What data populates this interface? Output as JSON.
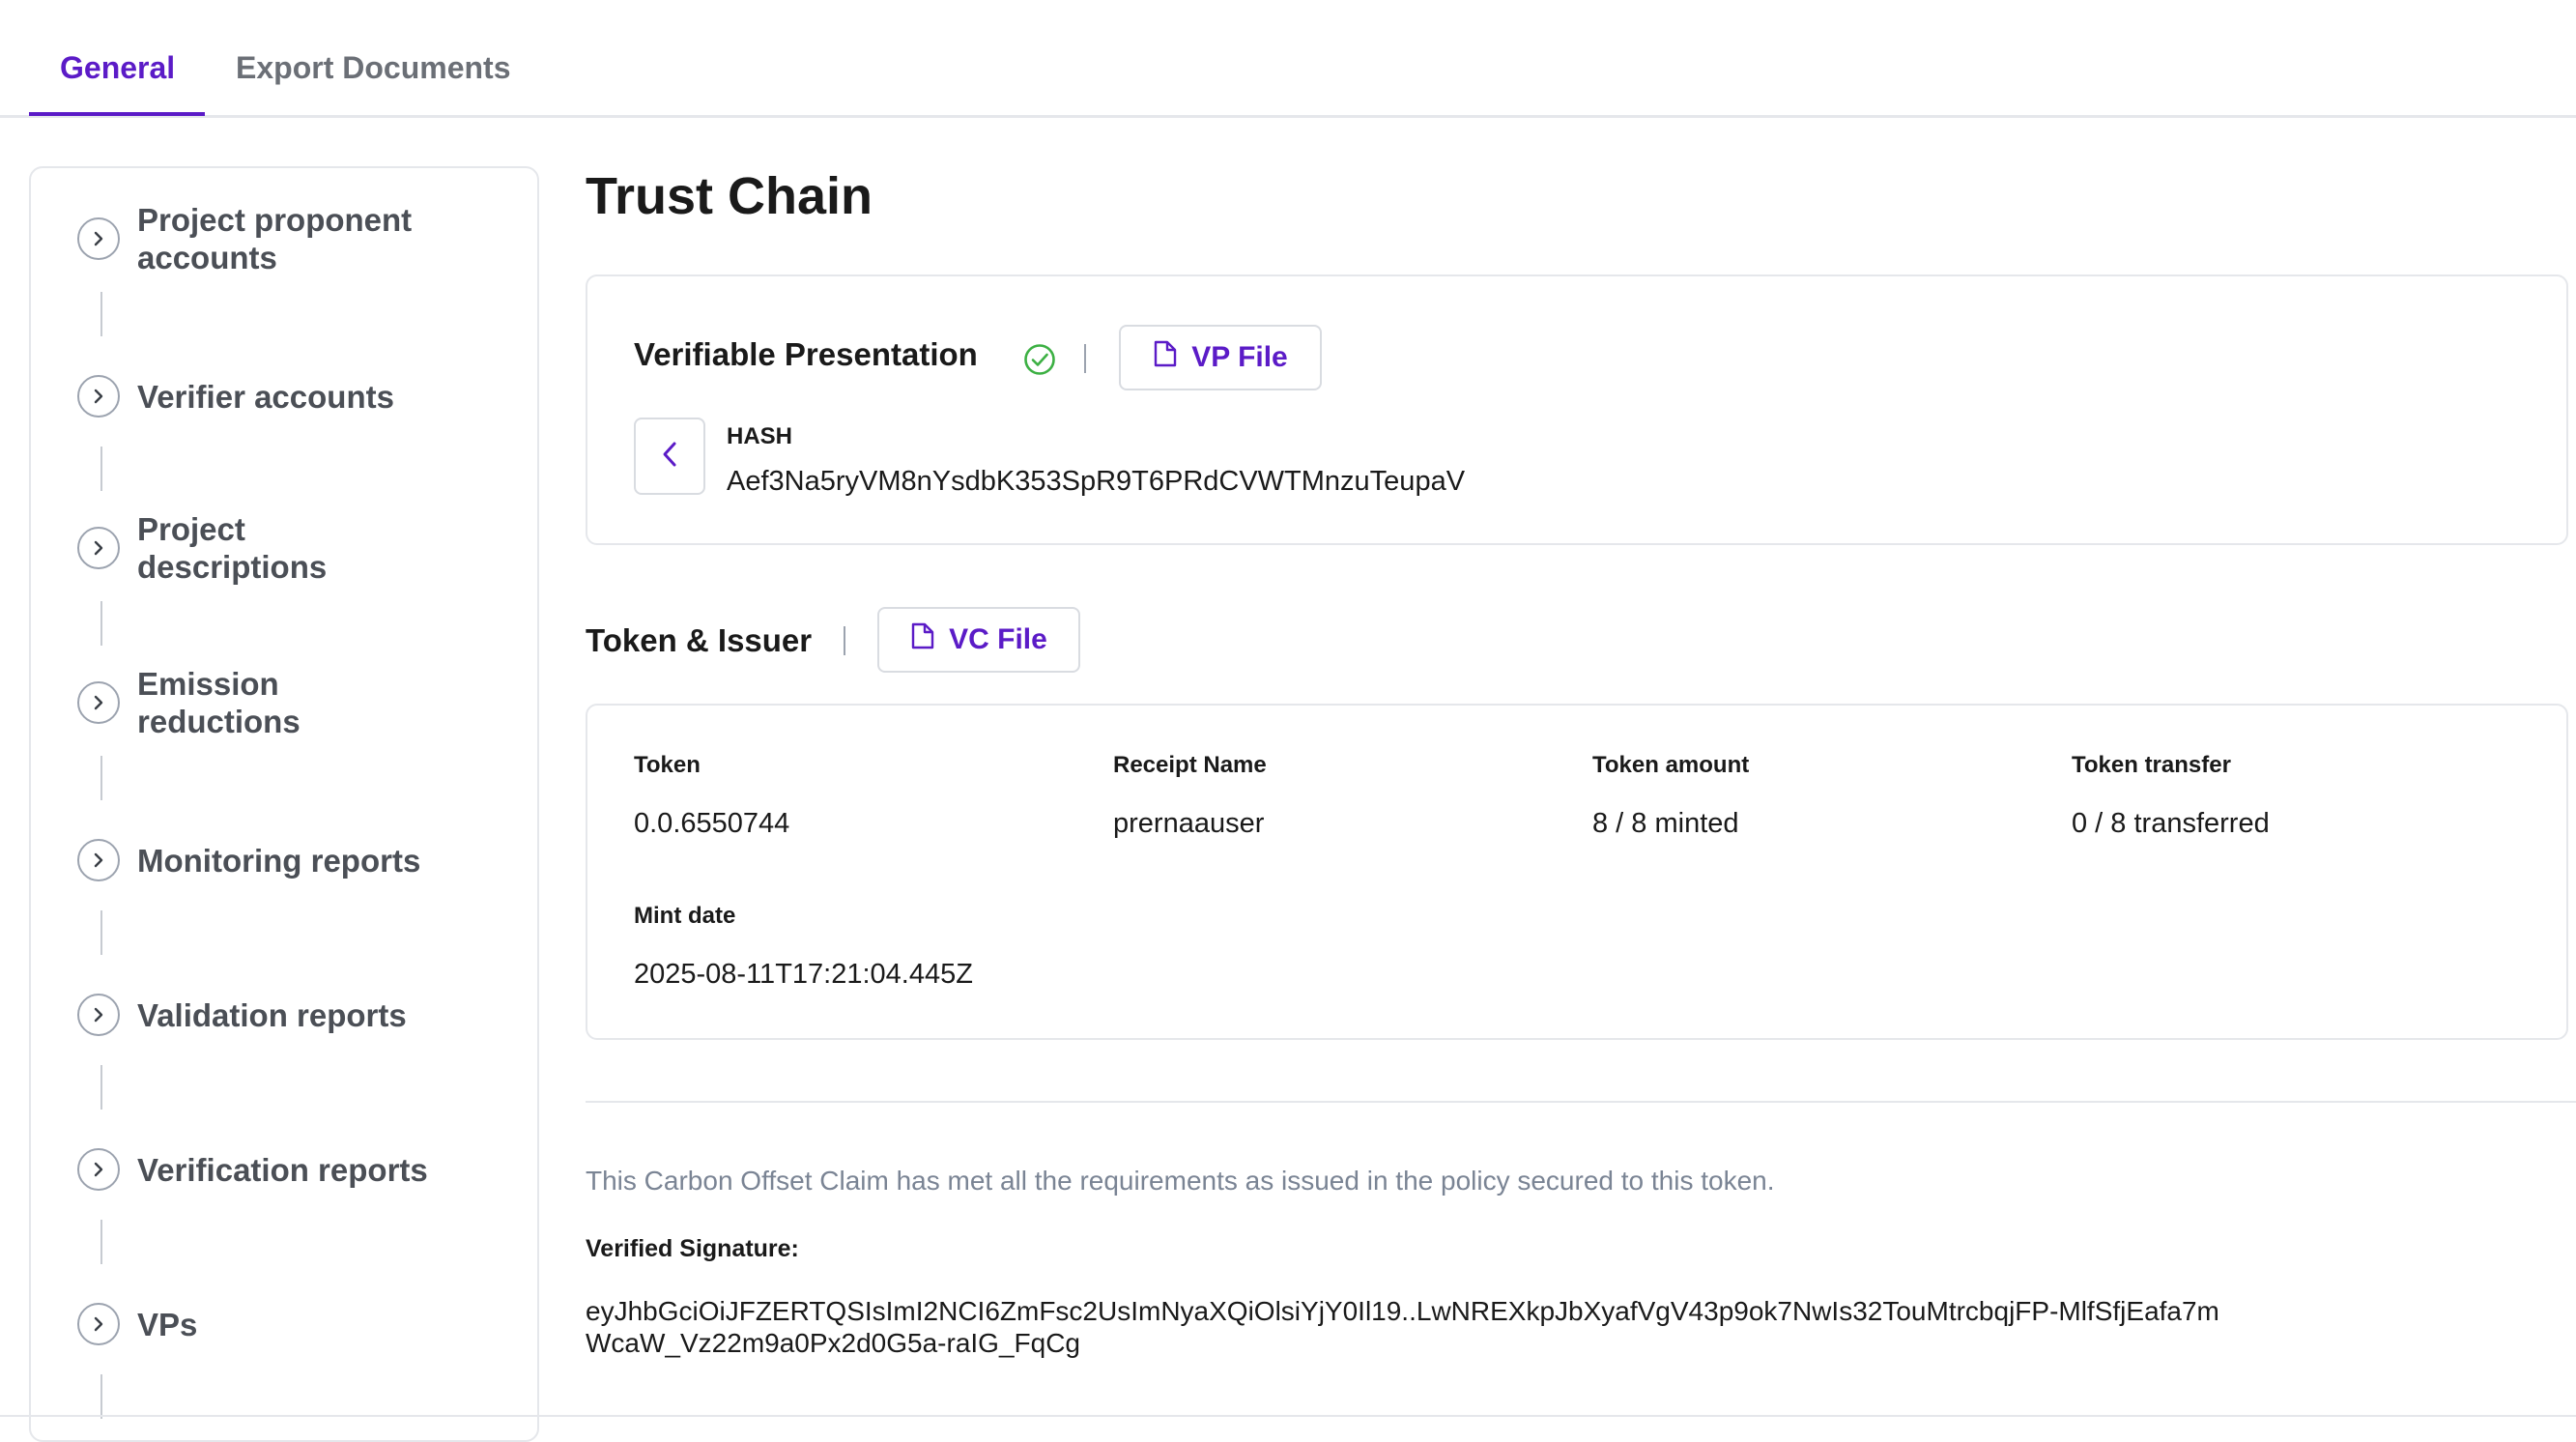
{
  "tabs": [
    {
      "label": "General"
    },
    {
      "label": "Export Documents"
    }
  ],
  "sidebar": {
    "items": [
      {
        "line1": "Project proponent",
        "line2": "accounts"
      },
      {
        "line1": "Verifier accounts",
        "line2": ""
      },
      {
        "line1": "Project",
        "line2": "descriptions"
      },
      {
        "line1": "Emission",
        "line2": "reductions"
      },
      {
        "line1": "Monitoring reports",
        "line2": ""
      },
      {
        "line1": "Validation reports",
        "line2": ""
      },
      {
        "line1": "Verification reports",
        "line2": ""
      },
      {
        "line1": "VPs",
        "line2": ""
      }
    ]
  },
  "page": {
    "title": "Trust Chain"
  },
  "vp": {
    "title": "Verifiable Presentation",
    "file_button": "VP File",
    "hash_label": "HASH",
    "hash_value": "Aef3Na5ryVM8nYsdbK353SpR9T6PRdCVWTMnzuTeupaV",
    "status_color": "#3cb043"
  },
  "token_issuer": {
    "title": "Token & Issuer",
    "file_button": "VC File",
    "fields": [
      {
        "label": "Token",
        "value": "0.0.6550744"
      },
      {
        "label": "Receipt Name",
        "value": "prernaauser"
      },
      {
        "label": "Token amount",
        "value": "8 / 8 minted"
      },
      {
        "label": "Token transfer",
        "value": "0 / 8 transferred"
      },
      {
        "label": "Mint date",
        "value": "2025-08-11T17:21:04.445Z"
      }
    ]
  },
  "claim": {
    "text": "This Carbon Offset Claim has met all the requirements as issued in the policy secured to this token.",
    "signature_label": "Verified Signature:",
    "signature_value": "eyJhbGciOiJFZERTQSIsImI2NCI6ZmFsc2UsImNyaXQiOlsiYjY0Il19..LwNREXkpJbXyafVgV43p9ok7NwIs32TouMtrcbqjFP-MlfSfjEafa7mWcaW_Vz22m9a0Px2d0G5a-raIG_FqCg"
  },
  "colors": {
    "accent": "#5b1bc7",
    "border": "#e5e7eb",
    "muted_text": "#7a8494"
  }
}
